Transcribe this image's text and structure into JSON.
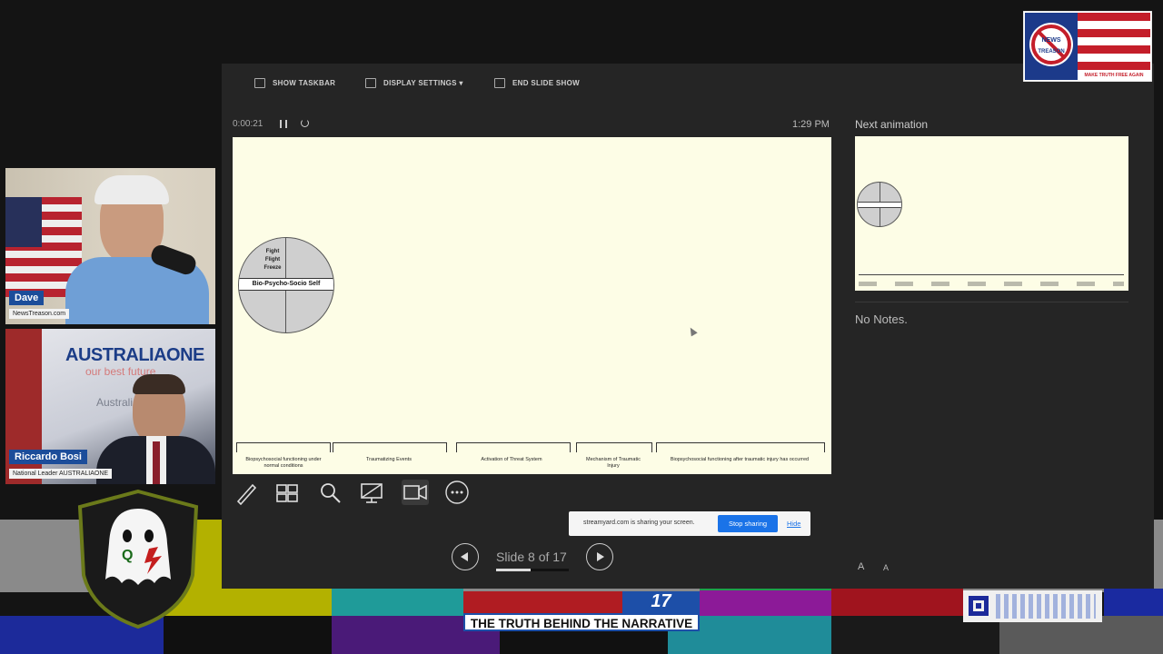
{
  "toolbar": {
    "show_taskbar": "SHOW TASKBAR",
    "display_settings": "DISPLAY SETTINGS ▾",
    "end_slide_show": "END SLIDE SHOW"
  },
  "timer": {
    "elapsed": "0:00:21",
    "clock": "1:29 PM"
  },
  "next_animation_label": "Next animation",
  "notes": "No Notes.",
  "slide": {
    "circle_top_text": [
      "Fight",
      "Flight",
      "Freeze"
    ],
    "circle_band": "Bio-Psycho-Socio Self",
    "ruler_labels": [
      "Biopsychosocial functioning under normal conditions",
      "Traumatizing Events",
      "Activation of Threat System",
      "Mechanism of Traumatic Injury",
      "Biopsychosocial functioning after traumatic injury has occurred"
    ]
  },
  "slide_counter": "Slide 8 of 17",
  "slide_progress": 0.47,
  "share_bar": {
    "message": "streamyard.com is sharing your screen.",
    "stop": "Stop sharing",
    "hide": "Hide"
  },
  "font_controls": {
    "increase": "A",
    "decrease": "A"
  },
  "participants": [
    {
      "name": "Dave",
      "subtitle": "NewsTreason.com"
    },
    {
      "name": "Riccardo Bosi",
      "subtitle": "National Leader AUSTRALIAONE"
    }
  ],
  "riccardo_background": {
    "brand": "AUSTRALIAONE",
    "tagline": "our best future",
    "partial": "AustraliaOn"
  },
  "ticker": "THE TRUTH BEHIND THE NARRATIVE",
  "ticker_badge": "17",
  "logo_news_treason": {
    "text_top": "NEWS",
    "text_bottom": "TREASON",
    "tagline": "MAKE TRUTH FREE AGAIN"
  },
  "colors": {
    "accent_blue": "#1a73e8",
    "name_tag": "#1c4d9a",
    "slide_bg": "#fdfde6"
  }
}
